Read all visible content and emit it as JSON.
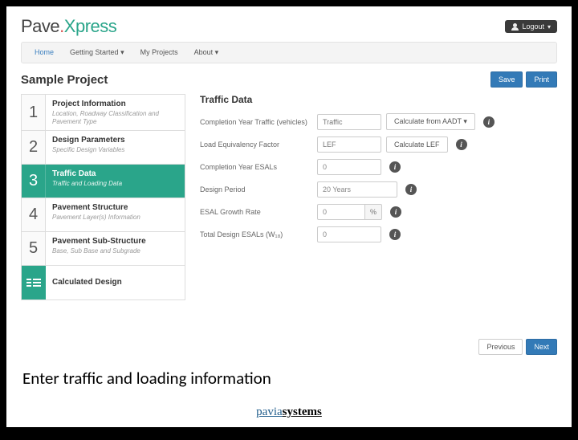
{
  "header": {
    "logo": {
      "part1": "Pave",
      "part2": "Xpress"
    },
    "logout_label": "Logout"
  },
  "nav": {
    "items": [
      "Home",
      "Getting Started",
      "My Projects",
      "About"
    ]
  },
  "page": {
    "title": "Sample Project",
    "save_label": "Save",
    "print_label": "Print"
  },
  "sidebar": {
    "steps": [
      {
        "num": "1",
        "title": "Project Information",
        "sub": "Location, Roadway Classification and Pavement Type"
      },
      {
        "num": "2",
        "title": "Design Parameters",
        "sub": "Specific Design Variables"
      },
      {
        "num": "3",
        "title": "Traffic Data",
        "sub": "Traffic and Loading Data"
      },
      {
        "num": "4",
        "title": "Pavement Structure",
        "sub": "Pavement Layer(s) Information"
      },
      {
        "num": "5",
        "title": "Pavement Sub-Structure",
        "sub": "Base, Sub Base and Subgrade"
      }
    ],
    "calculated_label": "Calculated Design"
  },
  "form": {
    "heading": "Traffic Data",
    "rows": {
      "completion_traffic": {
        "label": "Completion Year Traffic (vehicles)",
        "placeholder": "Traffic",
        "button": "Calculate from AADT"
      },
      "lef": {
        "label": "Load Equivalency Factor",
        "placeholder": "LEF",
        "button": "Calculate LEF"
      },
      "completion_esals": {
        "label": "Completion Year ESALs",
        "value": "0"
      },
      "design_period": {
        "label": "Design Period",
        "value": "20 Years"
      },
      "growth_rate": {
        "label": "ESAL Growth Rate",
        "value": "0",
        "unit": "%"
      },
      "total_esals": {
        "label": "Total Design ESALs (W₁₈)",
        "value": "0"
      }
    }
  },
  "pager": {
    "prev": "Previous",
    "next": "Next"
  },
  "caption": "Enter traffic and loading information",
  "footer": {
    "part1": "pavia",
    "part2": "systems"
  }
}
